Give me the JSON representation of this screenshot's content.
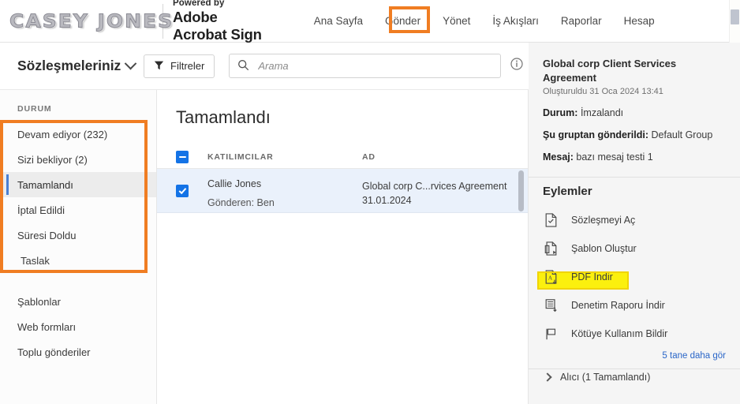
{
  "brand": {
    "logo_text": "CASEY JONES",
    "powered_by": "Powered by",
    "adobe": "Adobe",
    "product": "Acrobat Sign"
  },
  "nav": {
    "items": [
      {
        "label": "Ana Sayfa",
        "active": false
      },
      {
        "label": "Gönder",
        "active": false
      },
      {
        "label": "Yönet",
        "active": true
      },
      {
        "label": "İş Akışları",
        "active": false
      },
      {
        "label": "Raporlar",
        "active": false
      },
      {
        "label": "Hesap",
        "active": false
      }
    ],
    "highlight_color": "#f07d22"
  },
  "subbar": {
    "title": "Sözleşmeleriniz",
    "filter_label": "Filtreler",
    "search_placeholder": "Arama",
    "search_value": ""
  },
  "sidebar": {
    "section_label": "DURUM",
    "status_items": [
      {
        "label": "Devam ediyor (232)",
        "selected": false
      },
      {
        "label": "Sizi bekliyor (2)",
        "selected": false
      },
      {
        "label": "Tamamlandı",
        "selected": true
      },
      {
        "label": "İptal Edildi",
        "selected": false
      },
      {
        "label": "Süresi Doldu",
        "selected": false
      },
      {
        "label": "Taslak",
        "selected": false
      }
    ],
    "secondary_items": [
      {
        "label": "Şablonlar"
      },
      {
        "label": "Web formları"
      },
      {
        "label": "Toplu gönderiler"
      }
    ],
    "highlight_color": "#f07d22"
  },
  "main": {
    "heading": "Tamamlandı",
    "columns": [
      "KATILIMCILAR",
      "AD"
    ],
    "header_checkbox_state": "indeterminate",
    "rows": [
      {
        "checked": true,
        "participant": "Callie Jones",
        "sender": "Gönderen: Ben",
        "name": "Global corp C...rvices Agreement",
        "date": "31.01.2024"
      }
    ]
  },
  "details": {
    "title": "Global corp Client Services Agreement",
    "created": "Oluşturuldu 31 Oca 2024 13:41",
    "status_label": "Durum:",
    "status_value": "İmzalandı",
    "group_label": "Şu gruptan gönderildi:",
    "group_value": "Default Group",
    "message_label": "Mesaj:",
    "message_value": "bazı mesaj testi 1",
    "actions_title": "Eylemler",
    "actions": [
      {
        "label": "Sözleşmeyi Aç",
        "icon": "document-check-icon",
        "highlighted": false
      },
      {
        "label": "Şablon Oluştur",
        "icon": "document-template-icon",
        "highlighted": false
      },
      {
        "label": "PDF İndir",
        "icon": "pdf-download-icon",
        "highlighted": true
      },
      {
        "label": "Denetim Raporu İndir",
        "icon": "report-download-icon",
        "highlighted": false
      },
      {
        "label": "Kötüye Kullanım Bildir",
        "icon": "flag-icon",
        "highlighted": false
      }
    ],
    "see_more": "5 tane daha gör",
    "recipient_label": "Alıcı (1 Tamamlandı)",
    "highlight_color": "#fbf00e"
  }
}
